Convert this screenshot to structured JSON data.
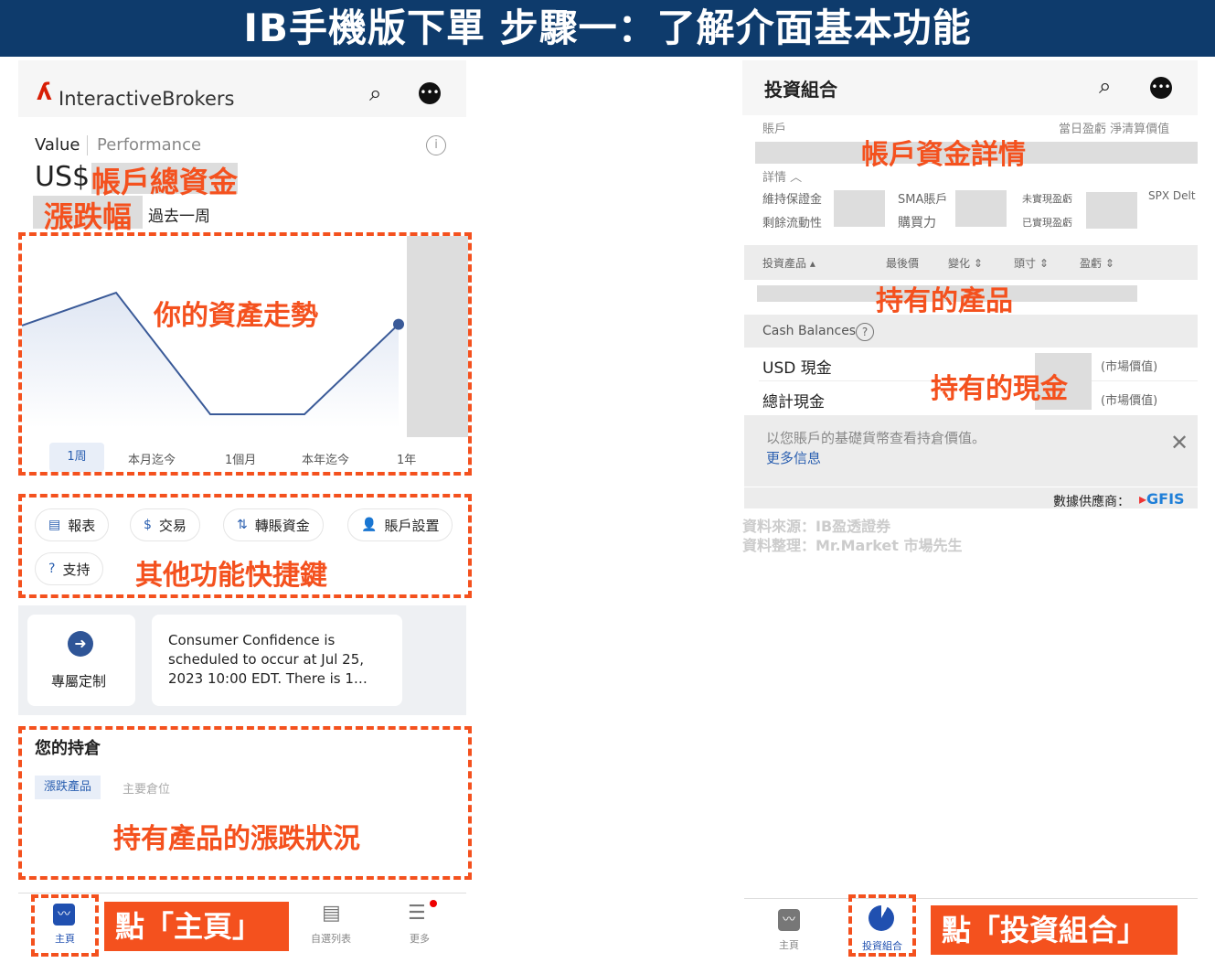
{
  "banner": {
    "title": "IB手機版下單 步驟一：了解介面基本功能"
  },
  "left": {
    "brand": "InteractiveBrokers",
    "tabs": {
      "value": "Value",
      "performance": "Performance"
    },
    "currency": "US$",
    "ann_total": "帳戶總資金",
    "ann_change": "漲跌幅",
    "period": "過去一周",
    "ann_trend": "你的資產走勢",
    "chart": {
      "type": "line",
      "series": [
        0.73,
        1.0,
        0.0,
        0.0,
        0.74
      ]
    },
    "ranges": [
      "1周",
      "本月迄今",
      "1個月",
      "本年迄今",
      "1年"
    ],
    "shortcuts": [
      {
        "label": "報表",
        "icon": "report-icon"
      },
      {
        "label": "交易",
        "icon": "trade-icon"
      },
      {
        "label": "轉賬資金",
        "icon": "transfer-icon"
      },
      {
        "label": "賬戶設置",
        "icon": "account-settings-icon"
      },
      {
        "label": "支持",
        "icon": "help-icon"
      }
    ],
    "ann_shortcuts": "其他功能快捷鍵",
    "custom": "專屬定制",
    "news": "Consumer Confidence is scheduled to occur at Jul 25, 2023 10:00 EDT. There is 1…",
    "holdings_title": "您的持倉",
    "holdings_tabs": [
      "漲跌產品",
      "主要倉位"
    ],
    "ann_holdings": "持有產品的漲跌狀況",
    "nav": [
      "主頁",
      "自選列表",
      "更多"
    ],
    "callout": "點「主頁」"
  },
  "right": {
    "title": "投資組合",
    "account": "賬戶",
    "daily_pl": "當日盈虧 淨清算價值",
    "ann_account": "帳戶資金詳情",
    "details": "詳情",
    "metrics": [
      "維持保證金",
      "剩餘流動性",
      "SMA賬戶",
      "購買力",
      "未實現盈虧",
      "已實現盈虧",
      "SPX Delt"
    ],
    "columns": [
      "投資產品",
      "最後價",
      "變化",
      "頭寸",
      "盈虧"
    ],
    "ann_products": "持有的產品",
    "cash_title": "Cash Balances",
    "cash_rows": [
      "USD 現金",
      "總計現金"
    ],
    "market_value": "(市場價值)",
    "ann_cash": "持有的現金",
    "notice": "以您賬戶的基礎貨幣查看持倉價值。",
    "more_info": "更多信息",
    "provider": "數據供應商：",
    "provider_logo": "GFIS",
    "source1": "資料來源：IB盈透證券",
    "source2": "資料整理：Mr.Market 市場先生",
    "nav": [
      "主頁",
      "投資組合"
    ],
    "callout": "點「投資組合」"
  }
}
